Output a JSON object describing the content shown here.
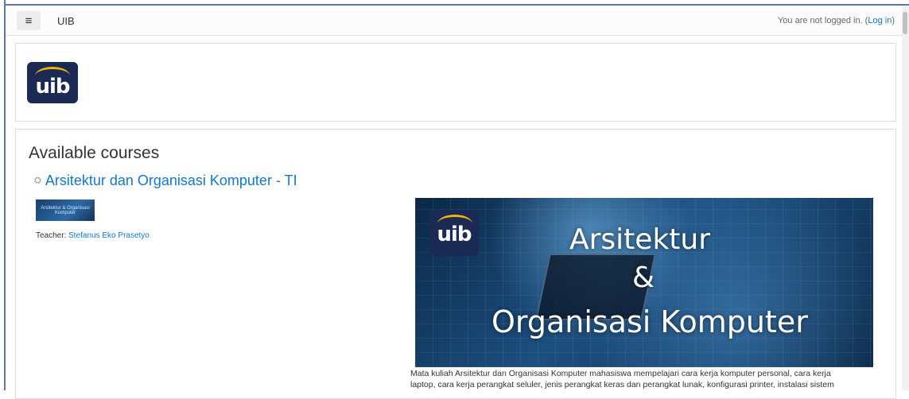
{
  "navbar": {
    "menu_icon": "hamburger-icon",
    "brand": "UIB",
    "login_prefix": "You are not logged in. (",
    "login_link": "Log in",
    "login_suffix": ")"
  },
  "logo": {
    "text": "uib"
  },
  "courses": {
    "section_title": "Available courses",
    "course_icon": "course-icon",
    "course_name": "Arsitektur dan Organisasi Komputer - TI",
    "thumbnail_caption": "Arsitektur & Organisasi Komputer",
    "teacher_label": "Teacher: ",
    "teacher_name": "Stefanus Eko Prasetyo",
    "banner": {
      "logo_text": "uib",
      "line1": "Arsitektur",
      "line2": "&",
      "line3": "Organisasi Komputer"
    },
    "summary": "Mata kuliah Arsitektur dan Organisasi Komputer mahasiswa mempelajari cara kerja komputer personal, cara kerja laptop, cara kerja perangkat seluler, jenis perangkat keras dan perangkat lunak, konfigurasi printer, instalasi sistem"
  }
}
